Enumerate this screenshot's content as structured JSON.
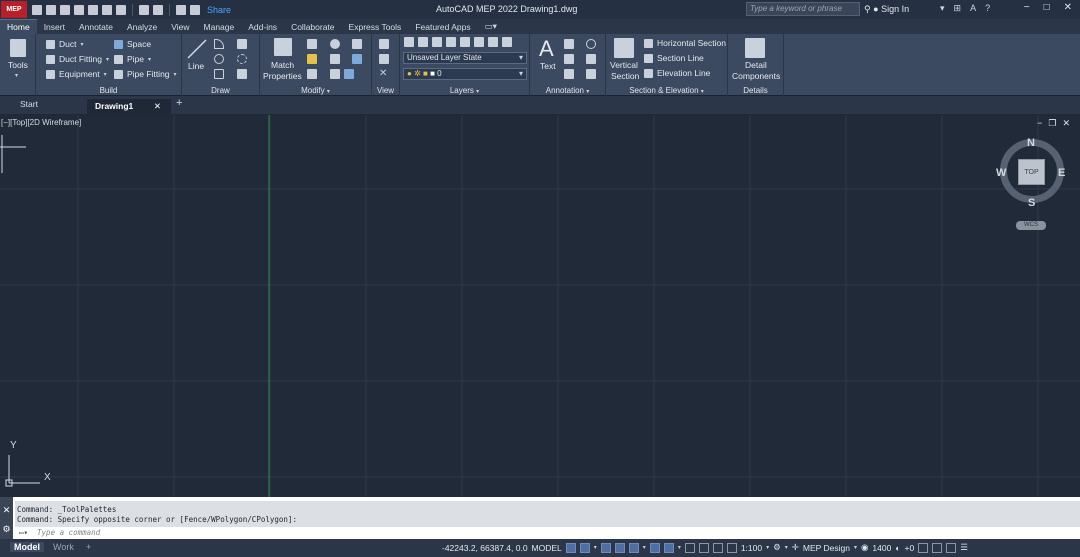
{
  "app": {
    "logo": "MEP",
    "share_label": "Share",
    "window_title": "AutoCAD MEP 2022    Drawing1.dwg",
    "search_placeholder": "Type a keyword or phrase",
    "signin_label": "Sign In"
  },
  "ribbon_tabs": [
    "Home",
    "Insert",
    "Annotate",
    "Analyze",
    "View",
    "Manage",
    "Add-ins",
    "Collaborate",
    "Express Tools",
    "Featured Apps"
  ],
  "panels": {
    "tools": {
      "label": "Tools"
    },
    "build": {
      "title": "Build",
      "items": [
        "Duct",
        "Duct Fitting",
        "Equipment",
        "Space",
        "Pipe",
        "Pipe Fitting"
      ]
    },
    "draw": {
      "title": "Draw",
      "line_label": "Line"
    },
    "modify": {
      "title": "Modify",
      "match_label": "Match",
      "properties_label": "Properties"
    },
    "view": {
      "title": "View"
    },
    "layers": {
      "title": "Layers",
      "layer_state": "Unsaved Layer State",
      "layer_value": "0"
    },
    "annotation": {
      "title": "Annotation",
      "text_label": "Text"
    },
    "section": {
      "title": "Section & Elevation",
      "vertical_label_1": "Vertical",
      "vertical_label_2": "Section",
      "items": [
        "Horizontal Section",
        "Section Line",
        "Elevation Line"
      ]
    },
    "details": {
      "title": "Details",
      "label_1": "Detail",
      "label_2": "Components"
    }
  },
  "file_tabs": {
    "start": "Start",
    "active": "Drawing1"
  },
  "viewport": {
    "label": "[−][Top][2D Wireframe]",
    "compass": {
      "n": "N",
      "s": "S",
      "e": "E",
      "w": "W"
    },
    "cube_label": "TOP",
    "wcs_label": "WCS",
    "ucs_x": "X",
    "ucs_y": "Y"
  },
  "command": {
    "history": [
      "Command: _ToolPalettes",
      "Command: Specify opposite corner or [Fence/WPolygon/CPolygon]:"
    ],
    "placeholder": "Type a command"
  },
  "status": {
    "layout_tabs": [
      "Model",
      "Work"
    ],
    "coordinates": "-42243.2, 66387.4, 0.0",
    "model_label": "MODEL",
    "scale": "1:100",
    "workspace": "MEP Design",
    "elevation": "1400",
    "plus_zero": "+0"
  },
  "colors": {
    "canvas": "#212a38",
    "grid": "#2e3a4b",
    "ribbon": "#3b4a60",
    "accent_red": "#b5202a",
    "share_blue": "#4aa3ff",
    "ucs_green": "#2d8a3e"
  }
}
